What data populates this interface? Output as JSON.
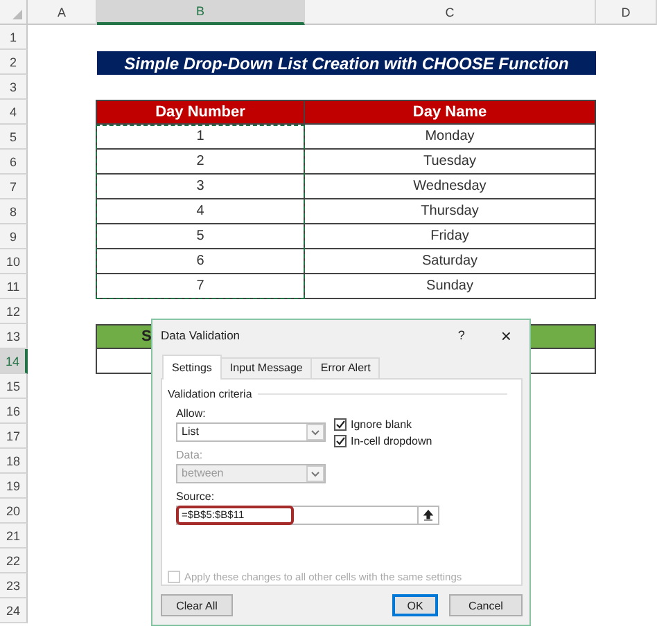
{
  "sheet": {
    "columns": [
      {
        "label": "A",
        "selected": false
      },
      {
        "label": "B",
        "selected": true
      },
      {
        "label": "C",
        "selected": false
      },
      {
        "label": "D",
        "selected": false
      }
    ],
    "rows": [
      {
        "label": "1",
        "selected": false
      },
      {
        "label": "2",
        "selected": false
      },
      {
        "label": "3",
        "selected": false
      },
      {
        "label": "4",
        "selected": false
      },
      {
        "label": "5",
        "selected": false
      },
      {
        "label": "6",
        "selected": false
      },
      {
        "label": "7",
        "selected": false
      },
      {
        "label": "8",
        "selected": false
      },
      {
        "label": "9",
        "selected": false
      },
      {
        "label": "10",
        "selected": false
      },
      {
        "label": "11",
        "selected": false
      },
      {
        "label": "12",
        "selected": false
      },
      {
        "label": "13",
        "selected": false
      },
      {
        "label": "14",
        "selected": true
      },
      {
        "label": "15",
        "selected": false
      },
      {
        "label": "16",
        "selected": false
      },
      {
        "label": "17",
        "selected": false
      },
      {
        "label": "18",
        "selected": false
      },
      {
        "label": "19",
        "selected": false
      },
      {
        "label": "20",
        "selected": false
      },
      {
        "label": "21",
        "selected": false
      },
      {
        "label": "22",
        "selected": false
      },
      {
        "label": "23",
        "selected": false
      },
      {
        "label": "24",
        "selected": false
      }
    ],
    "title": "Simple Drop-Down List Creation with CHOOSE Function",
    "table": {
      "columns": [
        "Day Number",
        "Day Name"
      ],
      "rows": [
        [
          "1",
          "Monday"
        ],
        [
          "2",
          "Tuesday"
        ],
        [
          "3",
          "Wednesday"
        ],
        [
          "4",
          "Thursday"
        ],
        [
          "5",
          "Friday"
        ],
        [
          "6",
          "Saturday"
        ],
        [
          "7",
          "Sunday"
        ]
      ]
    },
    "lower_table": {
      "header": "S"
    }
  },
  "dialog": {
    "title": "Data Validation",
    "help": "?",
    "close": "×",
    "tabs": [
      {
        "label": "Settings",
        "selected": true
      },
      {
        "label": "Input Message",
        "selected": false
      },
      {
        "label": "Error Alert",
        "selected": false
      }
    ],
    "section": "Validation criteria",
    "allow": {
      "label": "Allow:",
      "value": "List",
      "disabled": false
    },
    "data": {
      "label": "Data:",
      "value": "between",
      "disabled": true
    },
    "checkboxes": [
      {
        "label": "Ignore blank",
        "checked": true,
        "disabled": false
      },
      {
        "label": "In-cell dropdown",
        "checked": true,
        "disabled": false
      }
    ],
    "source": {
      "label": "Source:",
      "value": "=$B$5:$B$11"
    },
    "apply": {
      "label": "Apply these changes to all other cells with the same settings",
      "checked": false,
      "disabled": true
    },
    "buttons": [
      {
        "label": "Clear All",
        "default": false
      },
      {
        "label": "OK",
        "default": true
      },
      {
        "label": "Cancel",
        "default": false
      }
    ]
  }
}
